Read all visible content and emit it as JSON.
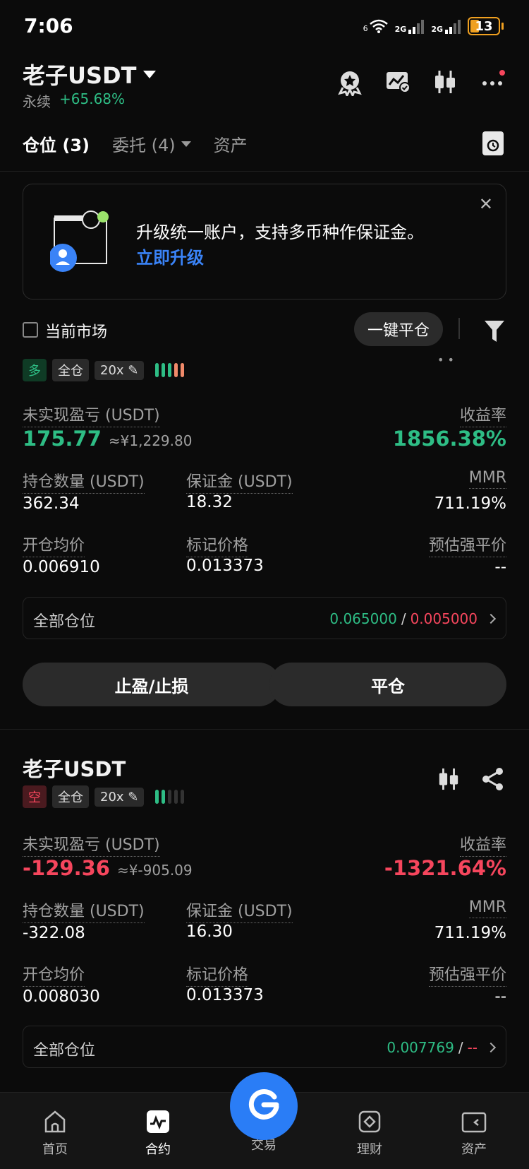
{
  "status_bar": {
    "time": "7:06",
    "battery": "13",
    "network_1": "2G",
    "network_2": "2G",
    "wifi_tag": "6"
  },
  "header": {
    "title": "老子USDT",
    "market_type": "永续",
    "change": "+65.68%"
  },
  "tabs": [
    {
      "label": "仓位 (3)"
    },
    {
      "label": "委托 (4)"
    },
    {
      "label": "资产"
    }
  ],
  "banner": {
    "text": "升级统一账户，支持多币种作保证金。",
    "link": "立即升级"
  },
  "filter": {
    "checkbox_label": "当前市场",
    "close_all": "一键平仓"
  },
  "positions": [
    {
      "symbol": "老子USDT",
      "side": "多",
      "margin_mode": "全仓",
      "leverage": "20x",
      "pnl_label": "未实现盈亏 (USDT)",
      "pnl": "175.77",
      "pnl_cny": "≈¥1,229.80",
      "roe_label": "收益率",
      "roe": "1856.38%",
      "size_label": "持仓数量 (USDT)",
      "size": "362.34",
      "margin_label": "保证金 (USDT)",
      "margin": "18.32",
      "mmr_label": "MMR",
      "mmr": "711.19%",
      "entry_label": "开仓均价",
      "entry": "0.006910",
      "mark_label": "标记价格",
      "mark": "0.013373",
      "liq_label": "预估强平价",
      "liq": "--",
      "all_label": "全部仓位",
      "tp": "0.065000",
      "sl": "0.005000",
      "btn_tpsl": "止盈/止损",
      "btn_close": "平仓"
    },
    {
      "symbol": "老子USDT",
      "side": "空",
      "margin_mode": "全仓",
      "leverage": "20x",
      "pnl_label": "未实现盈亏 (USDT)",
      "pnl": "-129.36",
      "pnl_cny": "≈¥-905.09",
      "roe_label": "收益率",
      "roe": "-1321.64%",
      "size_label": "持仓数量 (USDT)",
      "size": "-322.08",
      "margin_label": "保证金 (USDT)",
      "margin": "16.30",
      "mmr_label": "MMR",
      "mmr": "711.19%",
      "entry_label": "开仓均价",
      "entry": "0.008030",
      "mark_label": "标记价格",
      "mark": "0.013373",
      "liq_label": "预估强平价",
      "liq": "--",
      "all_label": "全部仓位",
      "tp": "0.007769",
      "sl": "--"
    }
  ],
  "nav": [
    {
      "label": "首页",
      "icon": "home-icon"
    },
    {
      "label": "合约",
      "icon": "contract-icon"
    },
    {
      "label": "交易",
      "icon": "trade-icon"
    },
    {
      "label": "理财",
      "icon": "finance-icon"
    },
    {
      "label": "资产",
      "icon": "wallet-icon"
    }
  ],
  "colors": {
    "green": "#2ebd85",
    "red": "#f6465d",
    "accent": "#2a7df6",
    "background": "#0b0b0b"
  }
}
